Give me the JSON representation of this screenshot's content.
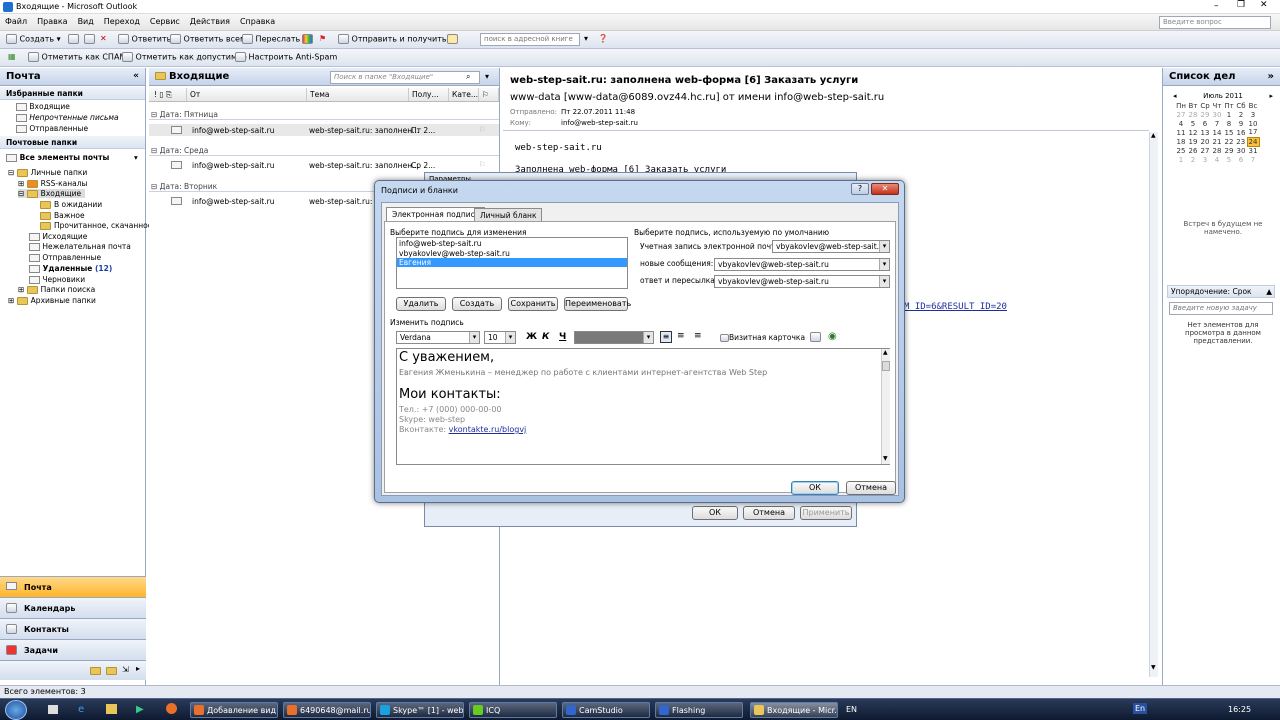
{
  "window": {
    "title": "Входящие - Microsoft Outlook",
    "help_placeholder": "Введите вопрос"
  },
  "menu": [
    "Файл",
    "Правка",
    "Вид",
    "Переход",
    "Сервис",
    "Действия",
    "Справка"
  ],
  "toolbar1": {
    "create": "Создать",
    "reply": "Ответить",
    "reply_all": "Ответить всем",
    "forward": "Переслать",
    "send_receive": "Отправить и получить",
    "address_search": "поиск в адресной книге"
  },
  "toolbar2": {
    "mark_spam": "Отметить как СПАМ",
    "mark_allowed": "Отметить как допустимое",
    "antispam": "Настроить Anti-Spam"
  },
  "nav": {
    "title": "Почта",
    "favorites_header": "Избранные папки",
    "favorites": [
      "Входящие",
      "Непрочтенные письма",
      "Отправленные"
    ],
    "mail_header": "Почтовые папки",
    "all_items": "Все элементы почты",
    "tree": [
      "Личные папки",
      "RSS-каналы",
      "Входящие",
      "В ожидании",
      "Важное",
      "Прочитанное, скачанное",
      "Исходящие",
      "Нежелательная почта",
      "Отправленные",
      "Удаленные",
      "Черновики",
      "Папки поиска",
      "Архивные папки"
    ],
    "deleted_count": "(12)",
    "buttons": [
      "Почта",
      "Календарь",
      "Контакты",
      "Задачи"
    ]
  },
  "list": {
    "title": "Входящие",
    "search_placeholder": "Поиск в папке \"Входящие\"",
    "columns": [
      "От",
      "Тема",
      "Полу...",
      "Кате..."
    ],
    "groups": [
      {
        "label": "Дата: Пятница",
        "from": "info@web-step-sait.ru",
        "subject": "web-step-sait.ru: заполнен...",
        "date": "Пт 2..."
      },
      {
        "label": "Дата: Среда",
        "from": "info@web-step-sait.ru",
        "subject": "web-step-sait.ru: заполнен...",
        "date": "Ср 2..."
      },
      {
        "label": "Дата: Вторник",
        "from": "info@web-step-sait.ru",
        "subject": "web-step-sait.ru: за",
        "date": ""
      }
    ]
  },
  "reading": {
    "subject": "web-step-sait.ru: заполнена web-форма [6] Заказать услуги",
    "from": "www-data [www-data@6089.ovz44.hc.ru] от имени info@web-step-sait.ru",
    "sent_label": "Отправлено:",
    "sent_value": "Пт 22.07.2011 11:48",
    "to_label": "Кому:",
    "to_value": "info@web-step-sait.ru",
    "body_line1": "web-step-sait.ru",
    "body_line2": "Заполнена web-форма [6] Заказать услуги",
    "link_fragment": "M_ID=6&RESULT_ID=20"
  },
  "todo": {
    "title": "Список дел",
    "month": "Июль 2011",
    "days": [
      "Пн",
      "Вт",
      "Ср",
      "Чт",
      "Пт",
      "Сб",
      "Вс"
    ],
    "weeks": [
      [
        "27",
        "28",
        "29",
        "30",
        "1",
        "2",
        "3"
      ],
      [
        "4",
        "5",
        "6",
        "7",
        "8",
        "9",
        "10"
      ],
      [
        "11",
        "12",
        "13",
        "14",
        "15",
        "16",
        "17"
      ],
      [
        "18",
        "19",
        "20",
        "21",
        "22",
        "23",
        "24"
      ],
      [
        "25",
        "26",
        "27",
        "28",
        "29",
        "30",
        "31"
      ],
      [
        "1",
        "2",
        "3",
        "4",
        "5",
        "6",
        "7"
      ]
    ],
    "today": "24",
    "no_meetings": "Встреч в будущем не намечено.",
    "sort_label": "Упорядочение: Срок",
    "task_placeholder": "Введите новую задачу",
    "no_items": "Нет элементов для просмотра в данном представлении."
  },
  "bg_dialog": {
    "title": "Параметры",
    "ok": "ОК",
    "cancel": "Отмена",
    "apply": "Применить"
  },
  "dialog": {
    "title": "Подписи и бланки",
    "tabs": [
      "Электронная подпись",
      "Личный бланк"
    ],
    "select_label": "Выберите подпись для изменения",
    "signatures": [
      "info@web-step-sait.ru",
      "vbyakovlev@web-step-sait.ru",
      "Евгения"
    ],
    "buttons": {
      "delete": "Удалить",
      "create": "Создать",
      "save": "Сохранить",
      "rename": "Переименовать"
    },
    "default_label": "Выберите подпись, используемую по умолчанию",
    "account_label": "Учетная запись электронной почты:",
    "account_value": "vbyakovlev@web-step-sait.ru",
    "new_label": "новые сообщения:",
    "new_value": "vbyakovlev@web-step-sait.ru",
    "reply_label": "ответ и пересылка:",
    "reply_value": "vbyakovlev@web-step-sait.ru",
    "edit_label": "Изменить подпись",
    "font": "Verdana",
    "size": "10",
    "bold": "Ж",
    "italic": "К",
    "underline": "Ч",
    "vcard": "Визитная карточка",
    "editor": {
      "line1": "С уважением,",
      "line2": "Евгения Жменькина – менеджер по работе с клиентами интернет-агентства Web Step",
      "line3": "Мои контакты:",
      "line4": "Тел.: +7 (000) 000-00-00",
      "line5": "Skype: web-step",
      "line6_label": "Вконтакте: ",
      "line6_link": "vkontakte.ru/blogvj"
    },
    "ok": "ОК",
    "cancel": "Отмена"
  },
  "status": "Всего элементов: 3",
  "taskbar": {
    "items": [
      "Добавление вид...",
      "6490648@mail.ru",
      "Skype™ [1] - web...",
      "ICQ",
      "CamStudio",
      "Flashing",
      "Входящие - Micr..."
    ],
    "lang": "EN",
    "lang2": "En",
    "time": "16:25"
  },
  "colors": {
    "accent": "#ffbf3a",
    "selection": "#3399ff",
    "link": "#1f2d9e"
  }
}
